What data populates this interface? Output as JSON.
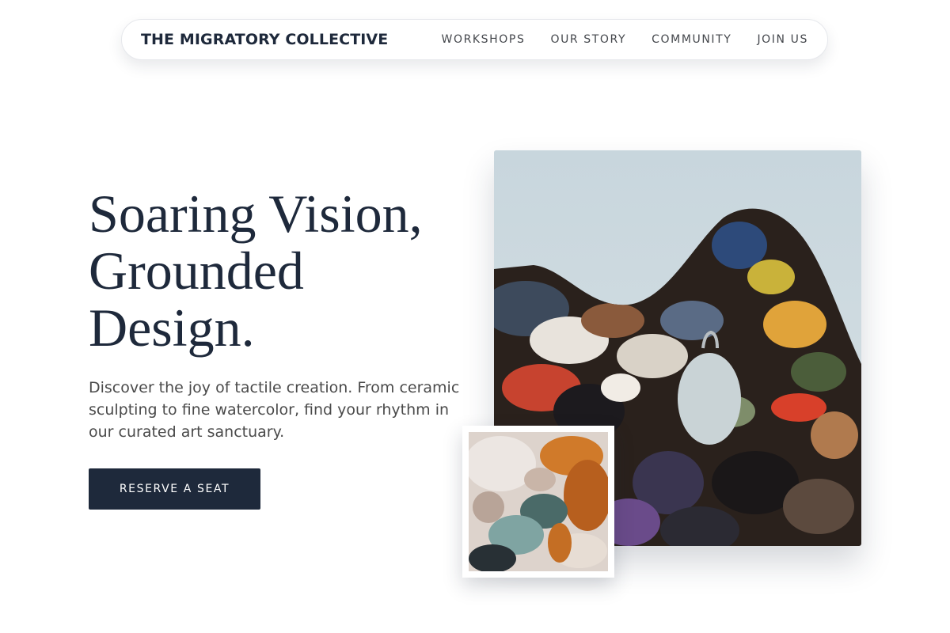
{
  "nav": {
    "brand": "THE MIGRATORY COLLECTIVE",
    "links": [
      "WORKSHOPS",
      "OUR STORY",
      "COMMUNITY",
      "JOIN US"
    ]
  },
  "hero": {
    "headline_lines": [
      "Soaring Vision,",
      "Grounded",
      "Design."
    ],
    "subtext": "Discover the joy of tactile creation. From ceramic sculpting to fine watercolor, find your rhythm in our curated art sanctuary.",
    "cta_label": "RESERVE A SEAT"
  },
  "colors": {
    "primary": "#1e293b",
    "text_muted": "#4a4a4a",
    "background": "#ffffff"
  },
  "images": {
    "main": "paint-palette-photo",
    "inset": "paint-texture-closeup-photo"
  }
}
